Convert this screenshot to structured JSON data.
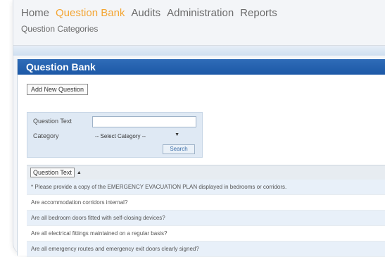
{
  "nav": {
    "items": [
      {
        "label": "Home",
        "active": false
      },
      {
        "label": "Question Bank",
        "active": true
      },
      {
        "label": "Audits",
        "active": false
      },
      {
        "label": "Administration",
        "active": false
      },
      {
        "label": "Reports",
        "active": false
      }
    ],
    "sub": "Question Categories"
  },
  "panel": {
    "title": "Question Bank",
    "add_button": "Add New Question"
  },
  "filter": {
    "question_text_label": "Question Text",
    "question_text_value": "",
    "category_label": "Category",
    "category_selected": "-- Select Category --",
    "search_button": "Search"
  },
  "results": {
    "column_header": "Question Text",
    "sort_indicator": "▲",
    "rows": [
      "* Please provide a copy of the EMERGENCY EVACUATION PLAN displayed in bedrooms or corridors.",
      "Are accommodation corridors internal?",
      "Are all bedroom doors fitted with self-closing devices?",
      "Are all electrical fittings maintained on a regular basis?",
      "Are all emergency routes and emergency exit doors clearly signed?"
    ]
  },
  "colors": {
    "accent": "#f3a533",
    "header_blue": "#1c58a6",
    "alt_row": "#e8f0f9"
  }
}
